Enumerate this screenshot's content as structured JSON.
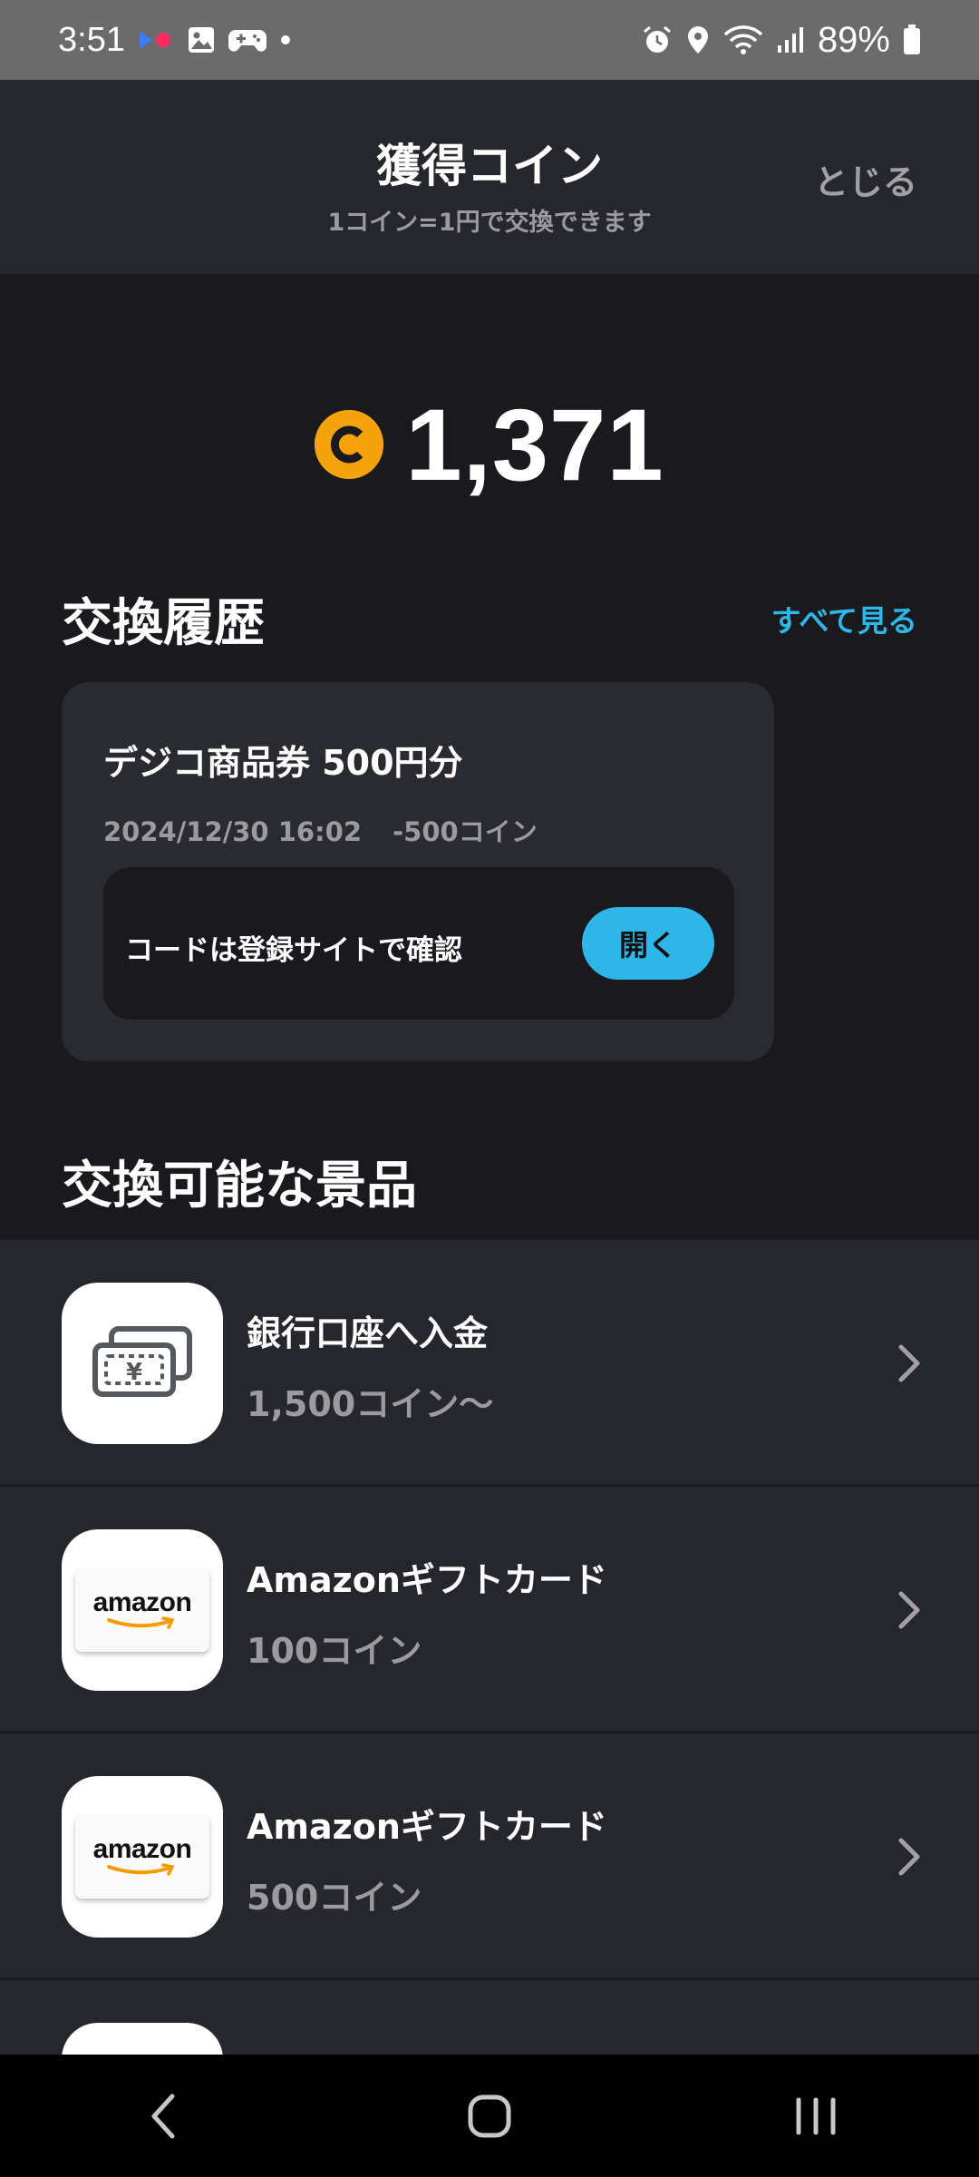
{
  "status_bar": {
    "time": "3:51",
    "battery": "89%",
    "left_icons": [
      "media-icon",
      "gallery-icon",
      "gamepad-icon",
      "dot-icon"
    ],
    "right_icons": [
      "alarm-icon",
      "location-icon",
      "wifi-icon",
      "signal-icon",
      "battery-icon"
    ]
  },
  "header": {
    "title": "獲得コイン",
    "subtitle": "1コイン=1円で交換できます",
    "close_label": "とじる"
  },
  "balance": {
    "coin_symbol": "C",
    "value": "1,371",
    "coin_color": "#f5a30d"
  },
  "history": {
    "section_title": "交換履歴",
    "see_all_label": "すべて見る",
    "card": {
      "title": "デジコ商品券 500円分",
      "datetime": "2024/12/30 16:02",
      "coins": "-500コイン",
      "code_label": "コードは登録サイトで確認",
      "open_label": "開く"
    }
  },
  "prizes": {
    "section_title": "交換可能な景品",
    "items": [
      {
        "name": "銀行口座へ入金",
        "cost": "1,500コイン〜",
        "icon": "bank-transfer-icon"
      },
      {
        "name": "Amazonギフトカード",
        "cost": "100コイン",
        "icon": "amazon-logo",
        "logo_text": "amazon"
      },
      {
        "name": "Amazonギフトカード",
        "cost": "500コイン",
        "icon": "amazon-logo",
        "logo_text": "amazon"
      }
    ]
  },
  "colors": {
    "accent": "#2fb6e8",
    "background": "#1a191e",
    "surface": "#26272c",
    "card": "#2a2b30",
    "muted_text": "#9a9aa0"
  }
}
